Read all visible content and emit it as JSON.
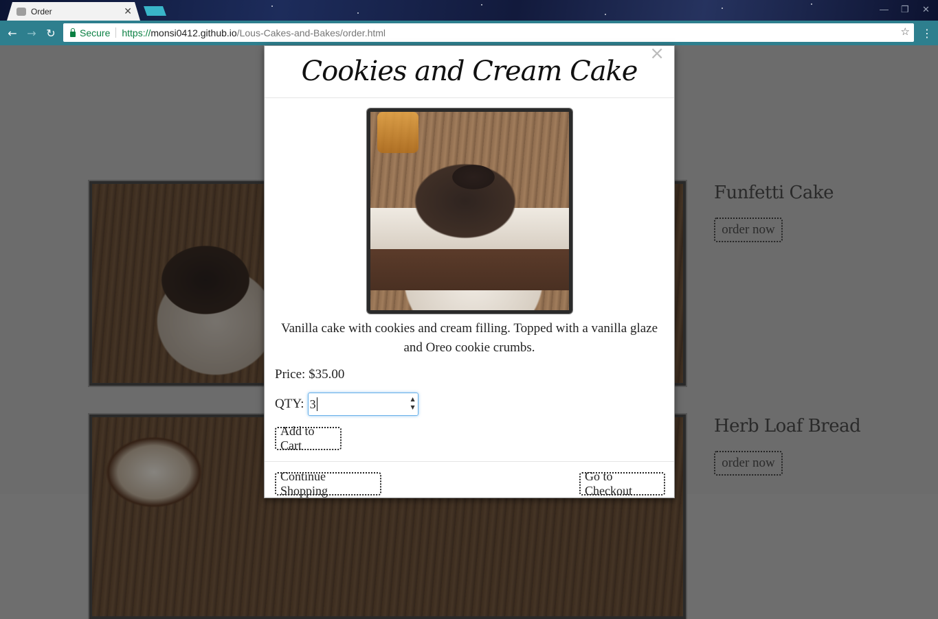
{
  "browser": {
    "tab_title": "Order",
    "tab_close": "✕",
    "secure_label": "Secure",
    "url_scheme": "https://",
    "url_host": "monsi0412.github.io",
    "url_path": "/Lous-Cakes-and-Bakes/order.html",
    "back_icon": "←",
    "forward_icon": "→",
    "reload_icon": "↻",
    "bookmark_icon": "☆",
    "menu_icon": "⋮",
    "minimize_icon": "—",
    "restore_icon": "❐",
    "window_close_icon": "✕"
  },
  "products": [
    {
      "name": "Funfetti Cake",
      "button": "order now"
    },
    {
      "name": "Herb Loaf Bread",
      "button": "order now"
    }
  ],
  "modal": {
    "title": "Cookies and Cream Cake",
    "close": "×",
    "description": "Vanilla cake with cookies and cream filling. Topped with a vanilla glaze and Oreo cookie crumbs.",
    "price": "Price: $35.00",
    "qty_label": "QTY:",
    "qty_value": "3",
    "qty_up": "▲",
    "qty_down": "▼",
    "add_to_cart": "Add to Cart",
    "continue_shopping": "Continue Shopping",
    "checkout": "Go to Checkout"
  }
}
